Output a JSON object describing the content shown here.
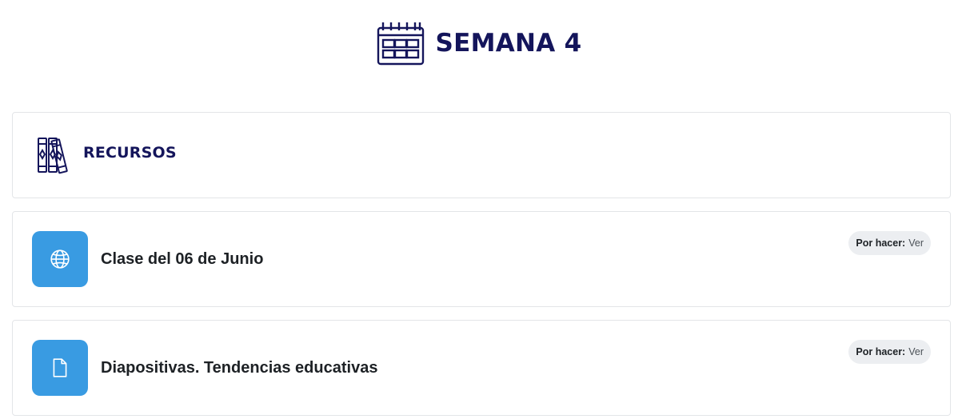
{
  "week": {
    "title": "SEMANA 4",
    "icon": "calendar-icon"
  },
  "section_label": {
    "title": "RECURSOS",
    "icon": "books-icon"
  },
  "activities": [
    {
      "name": "Clase del 06 de Junio",
      "icon": "globe-icon",
      "status_label": "Por hacer:",
      "status_value": "Ver"
    },
    {
      "name": "Diapositivas. Tendencias educativas",
      "icon": "file-icon",
      "status_label": "Por hacer:",
      "status_value": "Ver"
    }
  ],
  "colors": {
    "heading": "#14155b",
    "activity_icon_bg": "#399be2",
    "badge_bg": "#eceef1"
  }
}
